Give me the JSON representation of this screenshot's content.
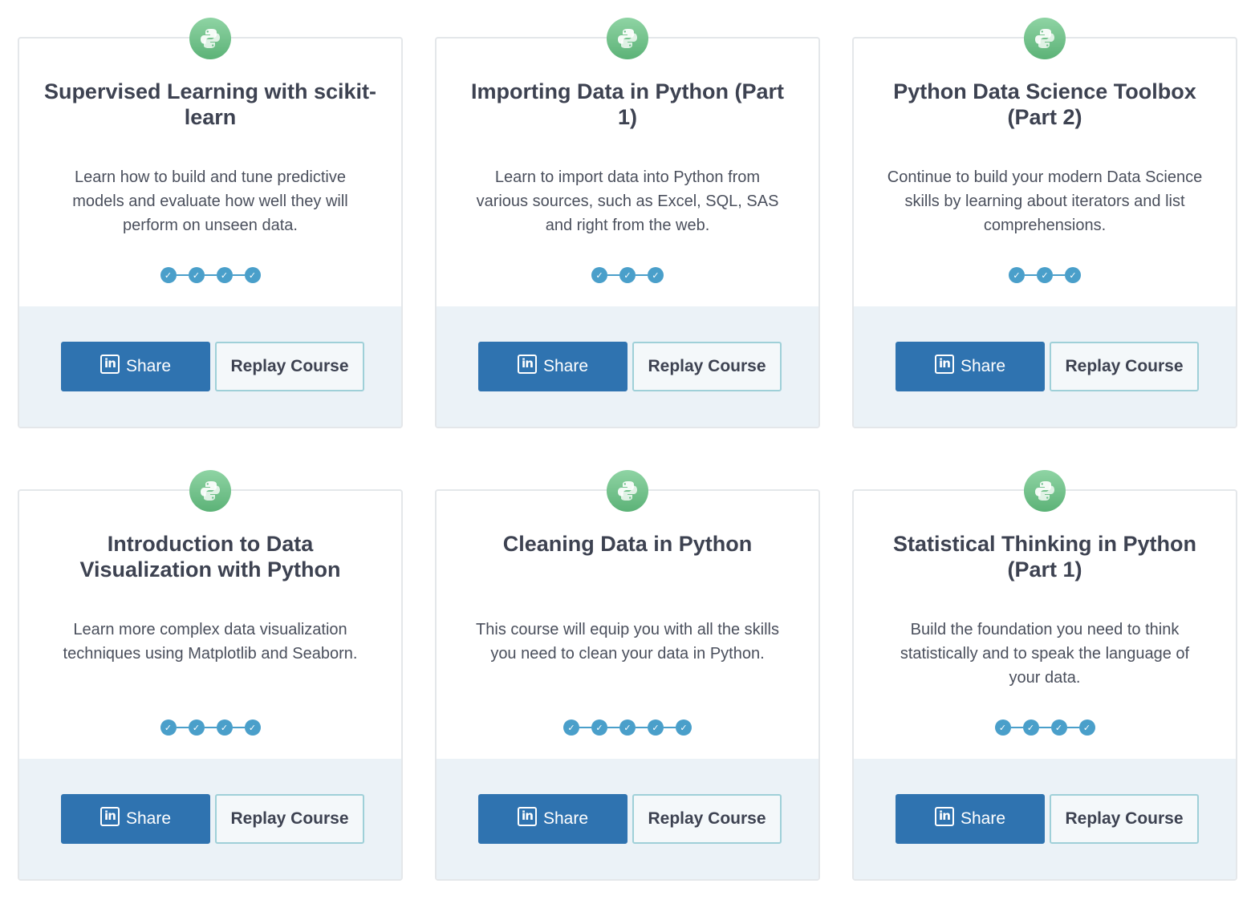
{
  "courses": [
    {
      "badge_icon": "python-icon",
      "title": "Supervised Learning with scikit-learn",
      "description": "Learn how to build and tune predictive models and evaluate how well they will perform on unseen data.",
      "chapters_completed": 4,
      "share_label": "Share",
      "replay_label": "Replay Course"
    },
    {
      "badge_icon": "python-icon",
      "title": "Importing Data in Python (Part 1)",
      "description": "Learn to import data into Python from various sources, such as Excel, SQL, SAS and right from the web.",
      "chapters_completed": 3,
      "share_label": "Share",
      "replay_label": "Replay Course"
    },
    {
      "badge_icon": "python-icon",
      "title": "Python Data Science Toolbox (Part 2)",
      "description": "Continue to build your modern Data Science skills by learning about iterators and list comprehensions.",
      "chapters_completed": 3,
      "share_label": "Share",
      "replay_label": "Replay Course"
    },
    {
      "badge_icon": "python-icon",
      "title": "Introduction to Data Visualization with Python",
      "description": "Learn more complex data visualization techniques using Matplotlib and Seaborn.",
      "chapters_completed": 4,
      "share_label": "Share",
      "replay_label": "Replay Course"
    },
    {
      "badge_icon": "python-icon",
      "title": "Cleaning Data in Python",
      "description": "This course will equip you with all the skills you need to clean your data in Python.",
      "chapters_completed": 5,
      "share_label": "Share",
      "replay_label": "Replay Course"
    },
    {
      "badge_icon": "python-icon",
      "title": "Statistical Thinking in Python (Part 1)",
      "description": "Build the foundation you need to think statistically and to speak the language of your data.",
      "chapters_completed": 4,
      "share_label": "Share",
      "replay_label": "Replay Course"
    }
  ],
  "icons": {
    "share": "linkedin-icon",
    "linkedin_glyph": "in",
    "check_glyph": "✓"
  },
  "colors": {
    "badge_green": "#6cc08a",
    "progress_blue": "#4a9fca",
    "share_blue": "#2f73b0",
    "replay_border": "#9fd0d8",
    "footer_bg": "#ebf2f7",
    "title_text": "#3d4251"
  }
}
